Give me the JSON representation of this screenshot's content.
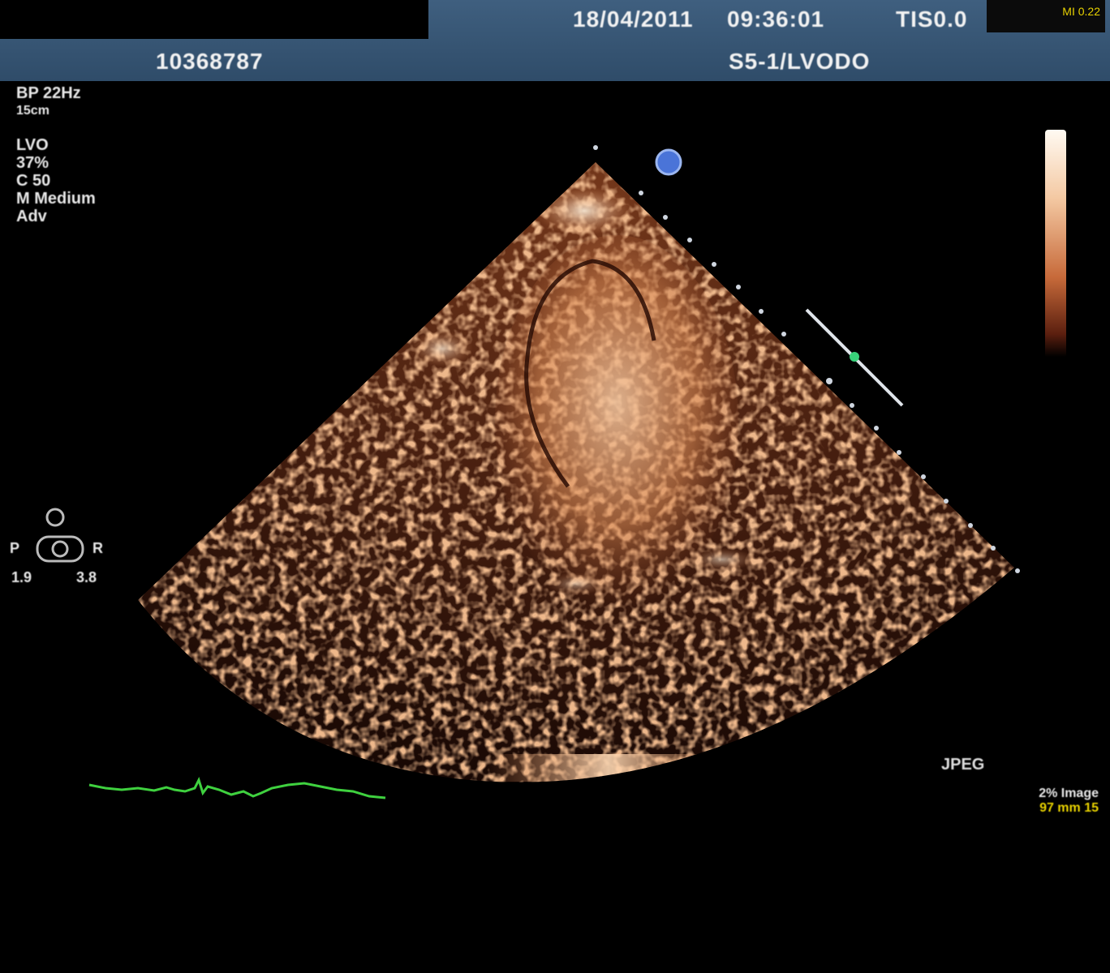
{
  "header": {
    "date": "18/04/2011",
    "time": "09:36:01",
    "tis": "TIS0.0",
    "patient_id": "10368787",
    "probe_label": "S5-1/LVODO",
    "badge_line1": "MI 0.22",
    "badge_line2": ""
  },
  "left_info": {
    "mode_line1": "BP 22Hz",
    "mode_line2": "15cm",
    "lines": [
      "LVO",
      "37%",
      "C 50",
      "M Medium",
      "Adv"
    ]
  },
  "probe_indicator": {
    "labels_top": "",
    "left": "P",
    "right": "R",
    "bottom_left": "1.9",
    "bottom_right": "3.8"
  },
  "scale": {
    "label": ""
  },
  "jpeg_label": "JPEG",
  "bottom_right": {
    "line1": "2% Image",
    "line2": "97 mm 15"
  },
  "colors": {
    "header": "#3a5a7a",
    "ecg": "#3fd13f",
    "accent_yellow": "#e8d200",
    "tissue": "#d98a55"
  }
}
